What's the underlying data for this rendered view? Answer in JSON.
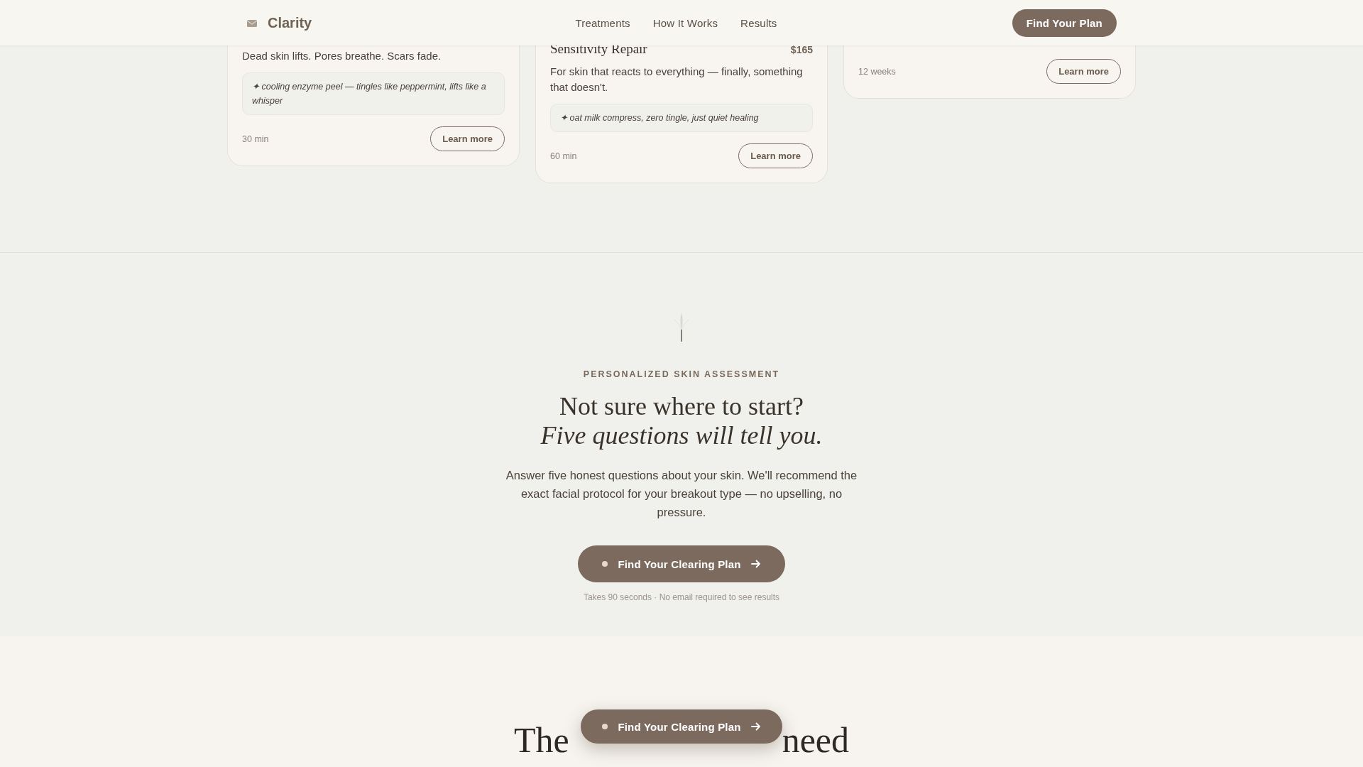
{
  "header": {
    "logo_text": "Clarity",
    "nav_links": [
      "Treatments",
      "How It Works",
      "Results"
    ],
    "cta": "Find Your Plan"
  },
  "treatment_cards": [
    {
      "description": "Dead skin lifts. Pores breathe. Scars fade.",
      "note": "✦ cooling enzyme peel — tingles like peppermint, lifts like a whisper",
      "duration": "30 min",
      "button": "Learn more"
    },
    {
      "title": "Sensitivity Repair",
      "price": "$165",
      "description": "For skin that reacts to everything — finally, something that doesn't.",
      "note": "✦ oat milk compress, zero tingle, just quiet healing",
      "duration": "60 min",
      "button": "Learn more"
    },
    {
      "duration": "12 weeks",
      "button": "Learn more"
    }
  ],
  "assessment": {
    "eyebrow": "PERSONALIZED SKIN ASSESSMENT",
    "heading_line_1": "Not sure where to start?",
    "heading_line_2": "Five questions will tell you.",
    "description": "Answer five honest questions about your skin. We'll recommend the exact facial protocol for your breakout type — no upselling, no pressure.",
    "button": "Find Your Clearing Plan",
    "footnote": "Takes 90 seconds · No email required to see results"
  },
  "results": {
    "heading_start": "The",
    "heading_end": "need"
  },
  "floating_button": {
    "label": "Find Your Clearing Plan"
  }
}
